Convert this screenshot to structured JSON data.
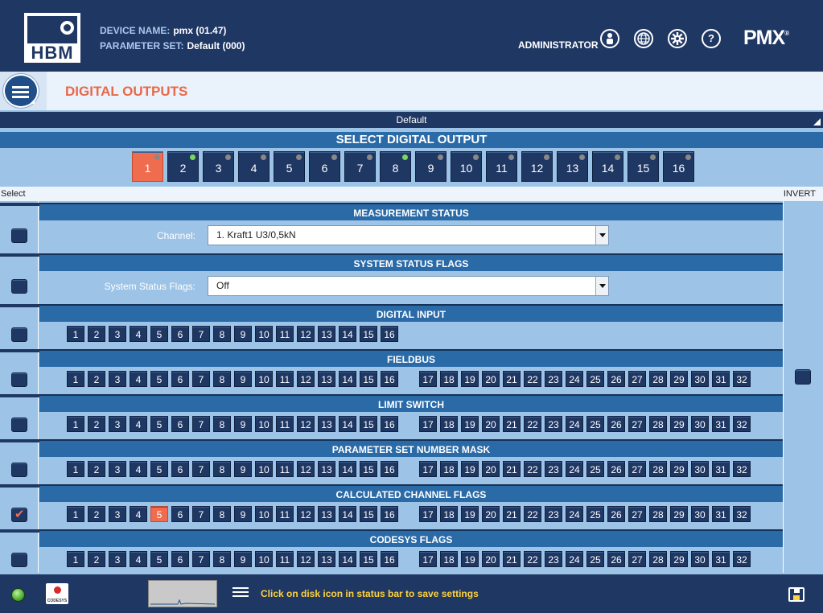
{
  "header": {
    "logo_text": "HBM",
    "device_name_label": "DEVICE NAME:",
    "device_name_value": "pmx (01.47)",
    "parameter_set_label": "PARAMETER SET:",
    "parameter_set_value": "Default (000)",
    "user_role": "ADMINISTRATOR",
    "brand": "PMX",
    "brand_mark": "®",
    "icons": [
      "user-icon",
      "globe-icon",
      "settings-icon",
      "help-icon"
    ]
  },
  "page": {
    "title": "DIGITAL OUTPUTS"
  },
  "parameter_set_bar": {
    "label": "Default"
  },
  "select_digital_output": {
    "title": "SELECT DIGITAL OUTPUT",
    "outputs": [
      {
        "label": "1",
        "selected": true,
        "led": "gray"
      },
      {
        "label": "2",
        "selected": false,
        "led": "green"
      },
      {
        "label": "3",
        "selected": false,
        "led": "gray"
      },
      {
        "label": "4",
        "selected": false,
        "led": "gray"
      },
      {
        "label": "5",
        "selected": false,
        "led": "gray"
      },
      {
        "label": "6",
        "selected": false,
        "led": "gray"
      },
      {
        "label": "7",
        "selected": false,
        "led": "gray"
      },
      {
        "label": "8",
        "selected": false,
        "led": "green"
      },
      {
        "label": "9",
        "selected": false,
        "led": "gray"
      },
      {
        "label": "10",
        "selected": false,
        "led": "gray"
      },
      {
        "label": "11",
        "selected": false,
        "led": "gray"
      },
      {
        "label": "12",
        "selected": false,
        "led": "gray"
      },
      {
        "label": "13",
        "selected": false,
        "led": "gray"
      },
      {
        "label": "14",
        "selected": false,
        "led": "gray"
      },
      {
        "label": "15",
        "selected": false,
        "led": "gray"
      },
      {
        "label": "16",
        "selected": false,
        "led": "gray"
      }
    ]
  },
  "columns": {
    "select_label": "Select",
    "invert_label": "INVERT"
  },
  "sections": [
    {
      "id": "measurement-status",
      "title": "MEASUREMENT STATUS",
      "checked": false,
      "kind": "select",
      "field_label": "Channel:",
      "value": "1. Kraft1 U3/0,5kN"
    },
    {
      "id": "system-status-flags",
      "title": "SYSTEM STATUS FLAGS",
      "checked": false,
      "kind": "select",
      "field_label": "System Status Flags:",
      "value": "Off"
    },
    {
      "id": "digital-input",
      "title": "DIGITAL INPUT",
      "checked": false,
      "kind": "bits",
      "count": 16,
      "active": []
    },
    {
      "id": "fieldbus",
      "title": "FIELDBUS",
      "checked": false,
      "kind": "bits",
      "count": 32,
      "active": []
    },
    {
      "id": "limit-switch",
      "title": "LIMIT SWITCH",
      "checked": false,
      "kind": "bits",
      "count": 32,
      "active": []
    },
    {
      "id": "parameter-set-number-mask",
      "title": "PARAMETER SET NUMBER MASK",
      "checked": false,
      "kind": "bits",
      "count": 32,
      "active": []
    },
    {
      "id": "calculated-channel-flags",
      "title": "CALCULATED CHANNEL FLAGS",
      "checked": true,
      "kind": "bits",
      "count": 32,
      "active": [
        5
      ]
    },
    {
      "id": "codesys-flags",
      "title": "CODESYS FLAGS",
      "checked": false,
      "kind": "bits",
      "count": 32,
      "active": []
    }
  ],
  "status_bar": {
    "codesys_label": "CODESYS",
    "message": "Click on disk icon in status bar to save settings",
    "colors": {
      "message": "#ffd23a",
      "accent": "#f06c4f",
      "navy": "#1f3763",
      "section_blue": "#2a6aa7"
    }
  }
}
